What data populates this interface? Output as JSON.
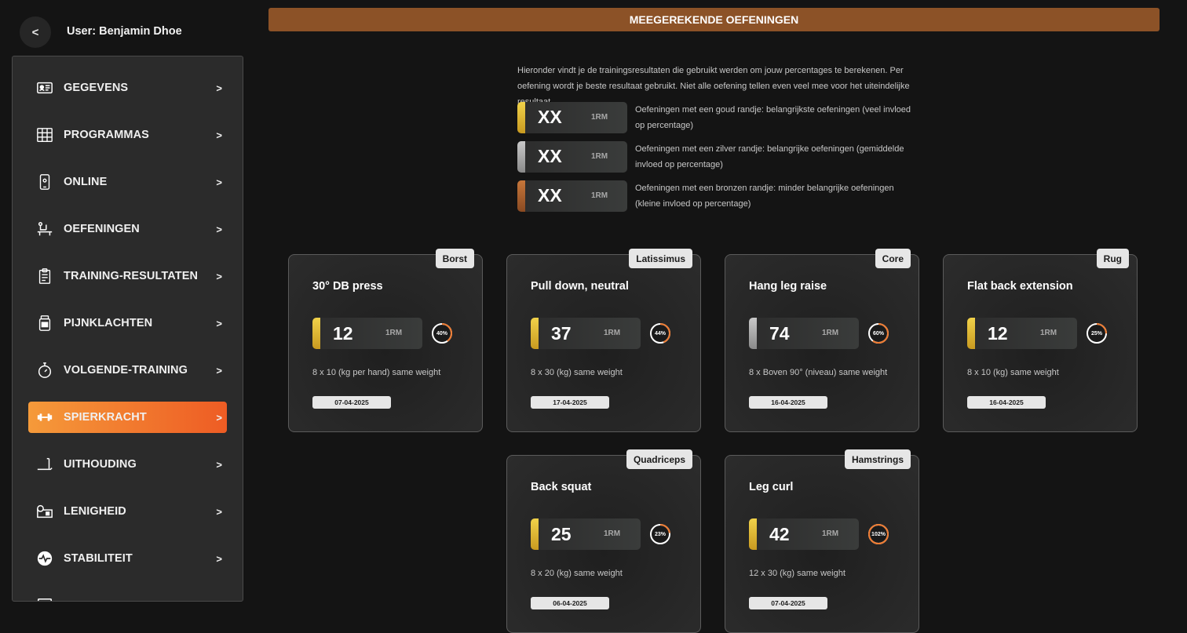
{
  "header": {
    "back_label": "<",
    "user_label": "User: Benjamin Dhoe"
  },
  "sidebar": {
    "arrow": ">",
    "items": [
      {
        "label": "GEGEVENS",
        "icon": "id-card-icon"
      },
      {
        "label": "PROGRAMMAS",
        "icon": "grid-calendar-icon"
      },
      {
        "label": "ONLINE",
        "icon": "phone-icon"
      },
      {
        "label": "OEFENINGEN",
        "icon": "bench-press-icon"
      },
      {
        "label": "TRAINING-RESULTATEN",
        "icon": "clipboard-icon"
      },
      {
        "label": "PIJNKLACHTEN",
        "icon": "medicine-jar-icon"
      },
      {
        "label": "VOLGENDE-TRAINING",
        "icon": "stopwatch-icon"
      },
      {
        "label": "SPIERKRACHT",
        "icon": "dumbbell-icon",
        "active": true
      },
      {
        "label": "UITHOUDING",
        "icon": "treadmill-icon"
      },
      {
        "label": "LENIGHEID",
        "icon": "yoga-mat-icon"
      },
      {
        "label": "STABILITEIT",
        "icon": "pulse-icon"
      }
    ]
  },
  "main": {
    "title": "MEEGEREKENDE OEFENINGEN",
    "intro": "Hieronder vindt je de trainingsresultaten die gebruikt werden om jouw percentages te berekenen. Per oefening wordt je beste resultaat gebruikt. Niet alle oefening tellen even veel mee voor het uiteindelijke resultaat.",
    "legend": [
      {
        "value": "XX",
        "unit": "1RM",
        "tier": "gold",
        "text": "Oefeningen met een goud randje: belangrijkste oefeningen (veel invloed op percentage)"
      },
      {
        "value": "XX",
        "unit": "1RM",
        "tier": "silver",
        "text": "Oefeningen met een zilver randje: belangrijke oefeningen (gemiddelde invloed op percentage)"
      },
      {
        "value": "XX",
        "unit": "1RM",
        "tier": "bronze",
        "text": "Oefeningen met een bronzen randje: minder belangrijke oefeningen (kleine invloed op percentage)"
      }
    ]
  },
  "colors": {
    "accent_start": "#f59a3a",
    "accent_end": "#ee5c24",
    "title_bar": "#8c5227",
    "gold": "#e2bd36",
    "silver": "#b0b0b0",
    "bronze": "#b0642e",
    "ring_orange": "#ee7a30"
  },
  "cards": [
    {
      "tag": "Borst",
      "name": "30° DB press",
      "value": "12",
      "unit": "1RM",
      "tier": "gold",
      "percent": 40,
      "percent_label": "40%",
      "detail": "8 x 10 (kg per hand) same weight",
      "date": "07-04-2025"
    },
    {
      "tag": "Latissimus",
      "name": "Pull down, neutral",
      "value": "37",
      "unit": "1RM",
      "tier": "gold",
      "percent": 44,
      "percent_label": "44%",
      "detail": "8 x 30 (kg) same weight",
      "date": "17-04-2025"
    },
    {
      "tag": "Core",
      "name": "Hang leg raise",
      "value": "74",
      "unit": "1RM",
      "tier": "silver",
      "percent": 60,
      "percent_label": "60%",
      "detail": "8 x Boven 90° (niveau) same weight",
      "date": "16-04-2025"
    },
    {
      "tag": "Rug",
      "name": "Flat back extension",
      "value": "12",
      "unit": "1RM",
      "tier": "gold",
      "percent": 25,
      "percent_label": "25%",
      "detail": "8 x 10 (kg) same weight",
      "date": "16-04-2025"
    },
    {
      "tag": "Quadriceps",
      "name": "Back squat",
      "value": "25",
      "unit": "1RM",
      "tier": "gold",
      "percent": 23,
      "percent_label": "23%",
      "detail": "8 x 20 (kg) same weight",
      "date": "06-04-2025"
    },
    {
      "tag": "Hamstrings",
      "name": "Leg curl",
      "value": "42",
      "unit": "1RM",
      "tier": "gold",
      "percent": 102,
      "percent_label": "102%",
      "detail": "12 x 30 (kg) same weight",
      "date": "07-04-2025"
    }
  ]
}
